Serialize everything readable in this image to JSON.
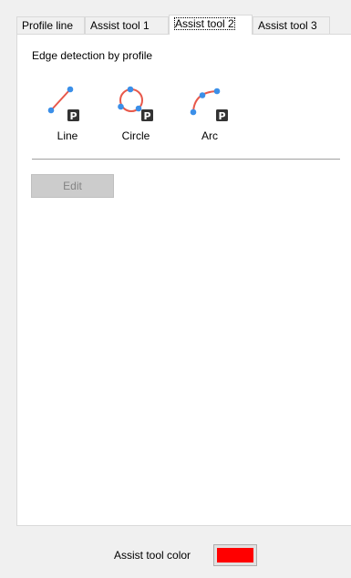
{
  "tabs": [
    {
      "label": "Profile line"
    },
    {
      "label": "Assist tool 1"
    },
    {
      "label": "Assist tool 2"
    },
    {
      "label": "Assist tool 3"
    }
  ],
  "active_tab": "Assist tool 2",
  "panel": {
    "heading": "Edge detection by profile",
    "tools": [
      {
        "label": "Line",
        "icon": "profile-line-icon",
        "badge": "P"
      },
      {
        "label": "Circle",
        "icon": "profile-circle-icon",
        "badge": "P"
      },
      {
        "label": "Arc",
        "icon": "profile-arc-icon",
        "badge": "P"
      }
    ],
    "edit_label": "Edit"
  },
  "footer": {
    "color_label": "Assist tool color",
    "color_value": "#ff0000"
  },
  "colors": {
    "accent_blue": "#3b8fe8",
    "shape_red": "#e8584a",
    "badge_dark": "#333333"
  }
}
